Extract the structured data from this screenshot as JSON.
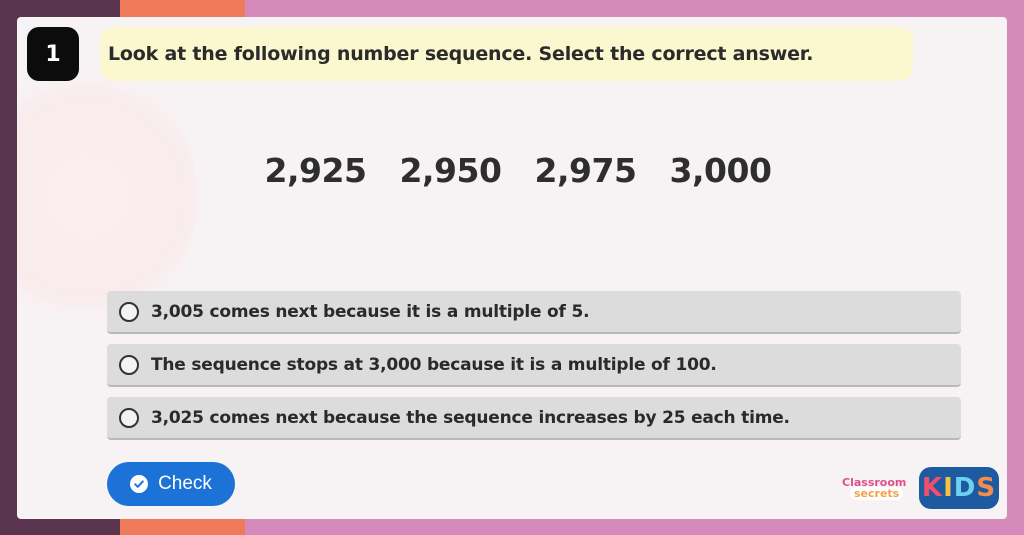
{
  "question": {
    "number": "1",
    "text": "Look at the following number sequence. Select the correct answer."
  },
  "sequence": [
    "2,925",
    "2,950",
    "2,975",
    "3,000"
  ],
  "options": [
    {
      "label": "3,005 comes next because it is a multiple of 5."
    },
    {
      "label": "The sequence stops at 3,000 because it is a multiple of 100."
    },
    {
      "label": "3,025 comes next because the sequence increases by 25 each time."
    }
  ],
  "check_button": {
    "label": "Check",
    "icon": "check-circle-icon"
  },
  "branding": {
    "classroom_secrets_line1": "Classroom",
    "classroom_secrets_line2": "secrets",
    "kids_logo": [
      "K",
      "I",
      "D",
      "S"
    ]
  },
  "colors": {
    "accent_blue": "#1d72d8",
    "question_bubble": "#fbf7cf",
    "option_bg": "#dcdcdc",
    "background_pink": "#d48bbb",
    "background_orange": "#ee7a5a",
    "background_dark": "#5b344f"
  }
}
